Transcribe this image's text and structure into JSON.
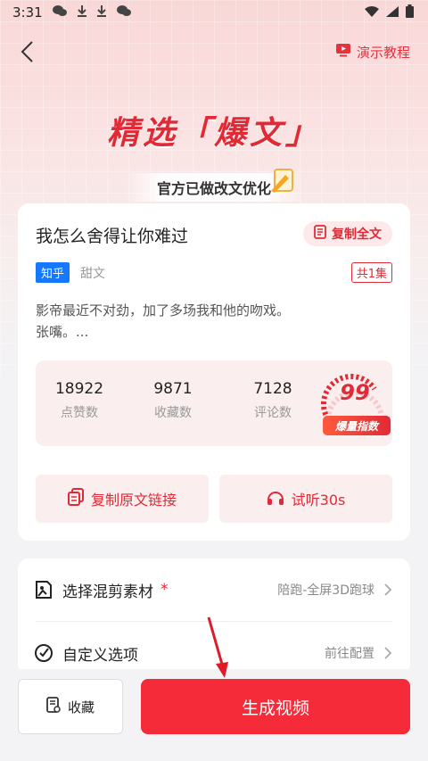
{
  "status_bar": {
    "time": "3:31"
  },
  "nav": {
    "tutorial_label": "演示教程"
  },
  "hero": {
    "title": "精选「爆文」",
    "subtitle": "官方已做改文优化"
  },
  "article": {
    "title": "我怎么舍得让你难过",
    "copy_all_label": "复制全文",
    "source_tag": "知乎",
    "genre_tag": "甜文",
    "episode_badge": "共1集",
    "summary_line1": "影帝最近不对劲，加了多场我和他的吻戏。",
    "summary_line2": "张嘴。..."
  },
  "stats": [
    {
      "value": "18922",
      "label": "点赞数"
    },
    {
      "value": "9871",
      "label": "收藏数"
    },
    {
      "value": "7128",
      "label": "评论数"
    }
  ],
  "score": {
    "value": "99",
    "label": "爆量指数"
  },
  "actions": {
    "copy_link_label": "复制原文链接",
    "listen_label": "试听30s"
  },
  "options": [
    {
      "label": "选择混剪素材",
      "required_mark": "*",
      "value": "陪跑-全屏3D跑球"
    },
    {
      "label": "自定义选项",
      "value": "前往配置"
    }
  ],
  "bottom": {
    "favorite_label": "收藏",
    "generate_label": "生成视频"
  },
  "colors": {
    "accent": "#e12a36",
    "primary_button": "#f52b3a",
    "source_tag": "#1677ff"
  }
}
